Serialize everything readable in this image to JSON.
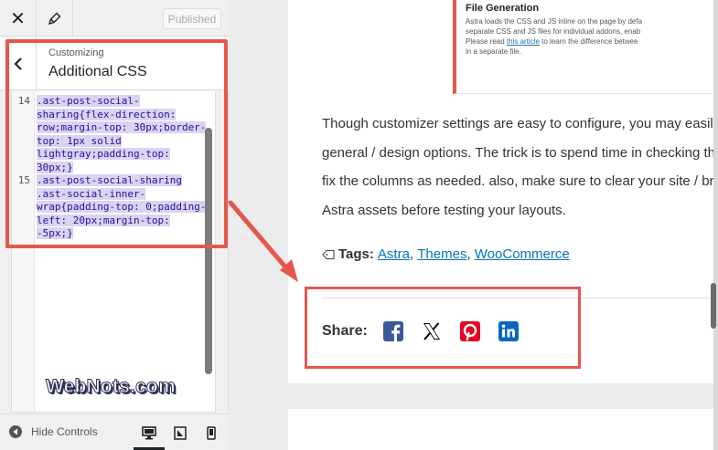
{
  "topbar": {
    "close_icon": "close-icon",
    "brush_icon": "paintbrush-icon",
    "publish_label": "Published"
  },
  "section": {
    "subtitle": "Customizing",
    "title": "Additional CSS",
    "help_glyph": "?"
  },
  "editor": {
    "line_numbers": [
      "14",
      "15"
    ],
    "code_lines": [
      ".ast-post-social-",
      "sharing{flex-direction:",
      "row;margin-top: 30px;border-",
      "top: 1px solid",
      "lightgray;padding-top:",
      "30px;}",
      ".ast-post-social-sharing",
      ".ast-social-inner-",
      "wrap{padding-top: 0;padding-",
      "left: 20px;margin-top:",
      "-5px;}"
    ]
  },
  "watermark": "WebNots.com",
  "footer": {
    "hide_label": "Hide Controls",
    "devices": [
      "desktop-icon",
      "tablet-icon",
      "mobile-icon"
    ]
  },
  "preview": {
    "thumb_title": "File Generation",
    "thumb_lines": [
      "Astra loads the CSS and JS inline on the page by defa",
      "separate CSS and JS files for individual addons, enab",
      "Please read ",
      "this article",
      " to learn the difference betwee",
      "in a separate file."
    ],
    "paragraph_lines": [
      "Though customizer settings are easy to configure, you may easily",
      "general / design options. The trick is to spend time in checking the",
      "fix the columns as needed. also, make sure to clear your site / brov",
      "Astra assets before testing your layouts."
    ],
    "tags_label": "Tags:",
    "tags": [
      "Astra",
      "Themes",
      "WooCommerce"
    ],
    "tag_separator": ",",
    "share_label": "Share:",
    "share_icons": [
      "facebook-icon",
      "x-icon",
      "pinterest-icon",
      "linkedin-icon"
    ]
  },
  "colors": {
    "highlight": "#e5574b",
    "link": "#0274be",
    "selection": "#d8d4f2"
  }
}
